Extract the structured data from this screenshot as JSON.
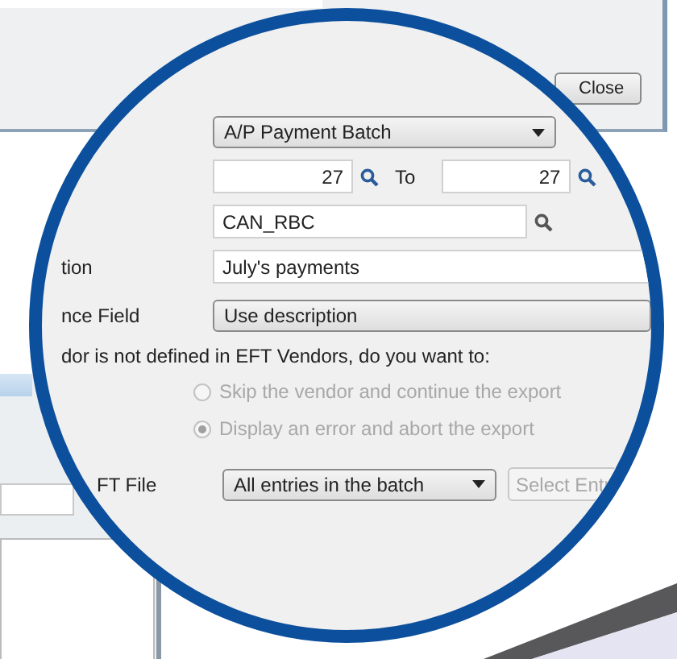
{
  "background_window": {
    "close_button": "Close"
  },
  "magnifier": {
    "document_type": "A/P Payment Batch",
    "from": "27",
    "to_label": "To",
    "to": "27",
    "bank": "CAN_RBC",
    "description_label": "tion",
    "description": "July's payments",
    "reference_label": "nce Field",
    "reference": "Use description",
    "vendor_prompt": "dor is not defined in EFT Vendors, do you want to:",
    "options": [
      {
        "label": "Skip the vendor and continue the export",
        "selected": false,
        "disabled": true
      },
      {
        "label": "Display an error and abort the export",
        "selected": true,
        "disabled": true
      }
    ],
    "file_label": "FT File",
    "entries": "All entries in the batch",
    "select_button": {
      "label": "Select Entr",
      "disabled": true
    }
  }
}
